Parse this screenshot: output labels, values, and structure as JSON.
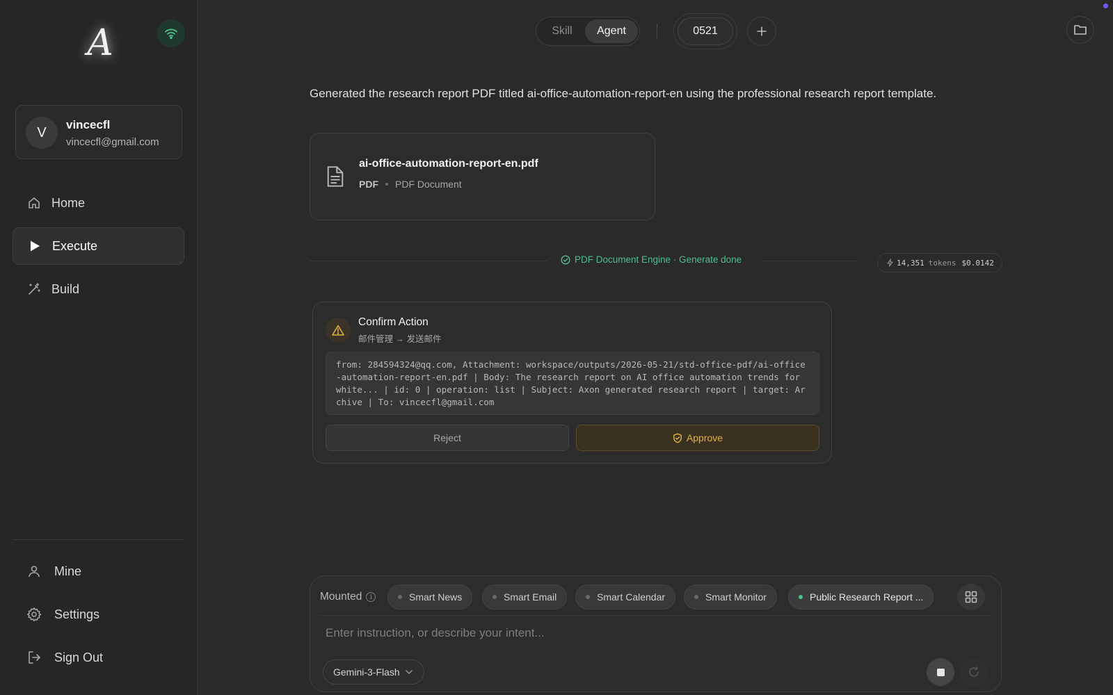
{
  "app": {
    "logo_letter": "A",
    "accent_green": "#4fbf8a",
    "accent_amber": "#e3b341"
  },
  "user": {
    "initial": "V",
    "name": "vincecfl",
    "email": "vincecfl@gmail.com"
  },
  "nav": {
    "home": "Home",
    "execute": "Execute",
    "build": "Build",
    "mine": "Mine",
    "settings": "Settings",
    "sign_out": "Sign Out"
  },
  "topbar": {
    "mode_skill": "Skill",
    "mode_agent": "Agent",
    "active_mode": "Agent",
    "session_id": "0521"
  },
  "conversation": {
    "message": "Generated the research report PDF titled ai-office-automation-report-en using the professional research report template.",
    "file": {
      "name": "ai-office-automation-report-en.pdf",
      "type": "PDF",
      "description": "PDF Document",
      "icon": "document-icon"
    },
    "status": {
      "text": "PDF Document Engine · Generate done",
      "tokens": "14,351",
      "tokens_unit": "tokens",
      "cost": "$0.0142"
    },
    "confirm": {
      "title": "Confirm Action",
      "subtitle": "邮件管理 → 发送邮件",
      "body": "from: 284594324@qq.com, Attachment: workspace/outputs/2026-05-21/std-office-pdf/ai-office-automation-report-en.pdf | Body: The research report on AI office automation trends for white... | id: 0 | operation: list | Subject: Axon generated research report | target: Archive | To: vincecfl@gmail.com",
      "reject_label": "Reject",
      "approve_label": "Approve"
    }
  },
  "composer": {
    "mounted_label": "Mounted",
    "chips": [
      {
        "label": "Smart News",
        "active": false
      },
      {
        "label": "Smart Email",
        "active": false
      },
      {
        "label": "Smart Calendar",
        "active": false
      },
      {
        "label": "Smart Monitor",
        "active": false
      },
      {
        "label": "Public Research Report ...",
        "active": true
      }
    ],
    "placeholder": "Enter instruction, or describe your intent...",
    "model": "Gemini-3-Flash"
  }
}
